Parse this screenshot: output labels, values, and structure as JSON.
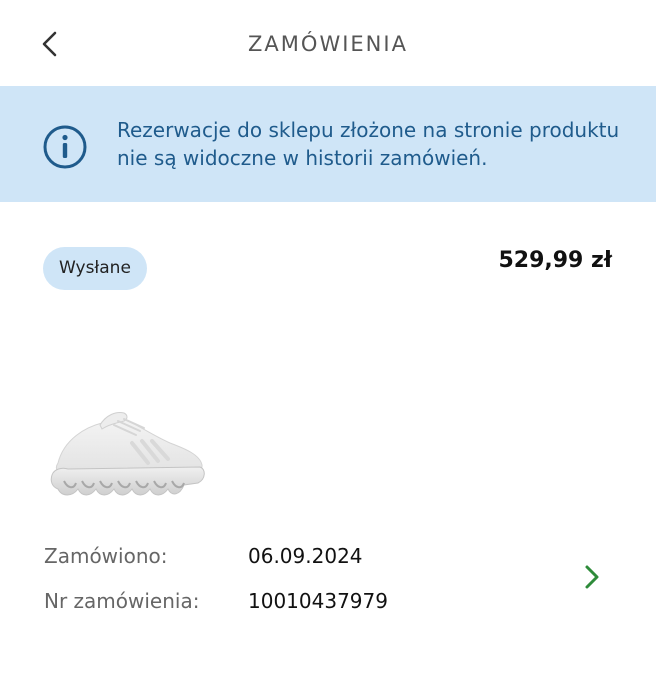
{
  "header": {
    "title": "ZAMÓWIENIA",
    "back_icon": "chevron-left-icon"
  },
  "info_banner": {
    "icon": "info-icon",
    "text": "Rezerwacje do sklepu złożone na stronie produktu nie są widoczne w historii zamówień.",
    "background": "#cfe5f7",
    "text_color": "#1f5b8c"
  },
  "order": {
    "status": "Wysłane",
    "price": "529,99 zł",
    "date_label": "Zamówiono:",
    "date_value": "06.09.2024",
    "number_label": "Nr zamówienia:",
    "number_value": "10010437979",
    "open_icon": "chevron-right-icon",
    "accent": "#2e8b3a"
  }
}
